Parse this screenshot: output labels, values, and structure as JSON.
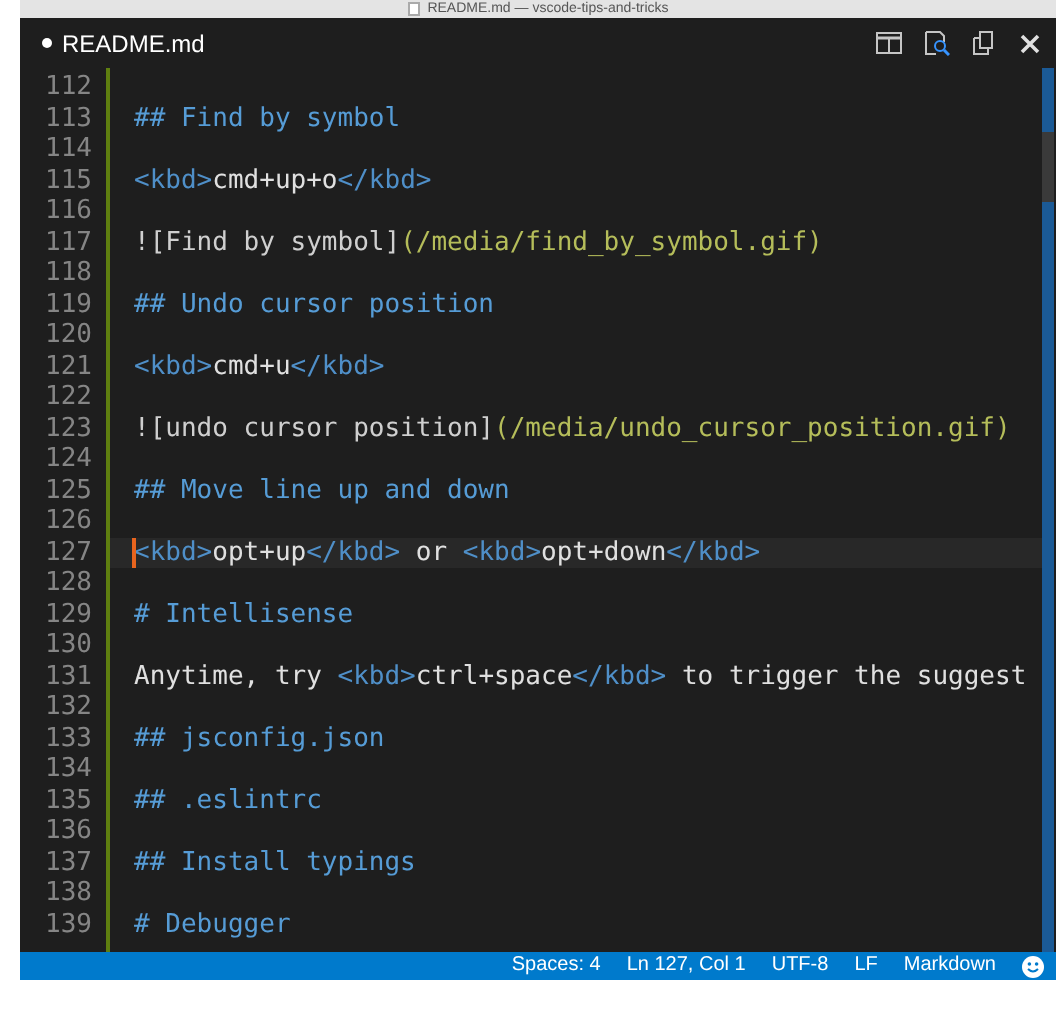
{
  "window": {
    "title": "README.md — vscode-tips-and-tricks"
  },
  "tabs": [
    {
      "label": "README.md",
      "dirty": true,
      "selected": true
    }
  ],
  "editor": {
    "lines": [
      {
        "number": "112",
        "current": false
      },
      {
        "number": "113",
        "current": false,
        "tokens": [
          {
            "kind": "heading",
            "text": "## Find by symbol"
          }
        ]
      },
      {
        "number": "114",
        "current": false
      },
      {
        "number": "115",
        "current": false,
        "tokens": [
          {
            "kind": "tag",
            "text": "<kbd>"
          },
          {
            "kind": "text",
            "text": "cmd+up+o"
          },
          {
            "kind": "tag",
            "text": "</kbd>"
          }
        ]
      },
      {
        "number": "116",
        "current": false
      },
      {
        "number": "117",
        "current": false,
        "tokens": [
          {
            "kind": "link_label",
            "text": "![Find by symbol]"
          },
          {
            "kind": "link_url",
            "text": "(/media/find_by_symbol.gif)"
          }
        ]
      },
      {
        "number": "118",
        "current": false
      },
      {
        "number": "119",
        "current": false,
        "tokens": [
          {
            "kind": "heading",
            "text": "## Undo cursor position"
          }
        ]
      },
      {
        "number": "120",
        "current": false
      },
      {
        "number": "121",
        "current": false,
        "tokens": [
          {
            "kind": "tag",
            "text": "<kbd>"
          },
          {
            "kind": "text",
            "text": "cmd+u"
          },
          {
            "kind": "tag",
            "text": "</kbd>"
          }
        ]
      },
      {
        "number": "122",
        "current": false
      },
      {
        "number": "123",
        "current": false,
        "tokens": [
          {
            "kind": "link_label",
            "text": "![undo cursor position]"
          },
          {
            "kind": "link_url",
            "text": "(/media/undo_cursor_position.gif)"
          }
        ]
      },
      {
        "number": "124",
        "current": false
      },
      {
        "number": "125",
        "current": false,
        "tokens": [
          {
            "kind": "heading",
            "text": "## Move line up and down"
          }
        ]
      },
      {
        "number": "126",
        "current": false
      },
      {
        "number": "127",
        "current": true,
        "tokens": [
          {
            "kind": "tag",
            "text": "<kbd>"
          },
          {
            "kind": "text",
            "text": "opt+up"
          },
          {
            "kind": "tag",
            "text": "</kbd>"
          },
          {
            "kind": "text",
            "text": " or "
          },
          {
            "kind": "tag",
            "text": "<kbd>"
          },
          {
            "kind": "text",
            "text": "opt+down"
          },
          {
            "kind": "tag",
            "text": "</kbd>"
          }
        ]
      },
      {
        "number": "128",
        "current": false
      },
      {
        "number": "129",
        "current": false,
        "tokens": [
          {
            "kind": "heading",
            "text": "# Intellisense"
          }
        ]
      },
      {
        "number": "130",
        "current": false
      },
      {
        "number": "131",
        "current": false,
        "tokens": [
          {
            "kind": "text",
            "text": "Anytime, try "
          },
          {
            "kind": "tag",
            "text": "<kbd>"
          },
          {
            "kind": "text",
            "text": "ctrl+space"
          },
          {
            "kind": "tag",
            "text": "</kbd>"
          },
          {
            "kind": "text",
            "text": " to trigger the suggest"
          }
        ]
      },
      {
        "number": "132",
        "current": false
      },
      {
        "number": "133",
        "current": false,
        "tokens": [
          {
            "kind": "heading",
            "text": "## jsconfig.json"
          }
        ]
      },
      {
        "number": "134",
        "current": false
      },
      {
        "number": "135",
        "current": false,
        "tokens": [
          {
            "kind": "heading",
            "text": "## .eslintrc"
          }
        ]
      },
      {
        "number": "136",
        "current": false
      },
      {
        "number": "137",
        "current": false,
        "tokens": [
          {
            "kind": "heading",
            "text": "## Install typings"
          }
        ]
      },
      {
        "number": "138",
        "current": false
      },
      {
        "number": "139",
        "current": false,
        "tokens": [
          {
            "kind": "heading",
            "text": "# Debugger"
          }
        ]
      }
    ]
  },
  "status_bar": {
    "items": [
      "Spaces: 4",
      "Ln 127, Col 1",
      "UTF-8",
      "LF",
      "Markdown"
    ]
  }
}
